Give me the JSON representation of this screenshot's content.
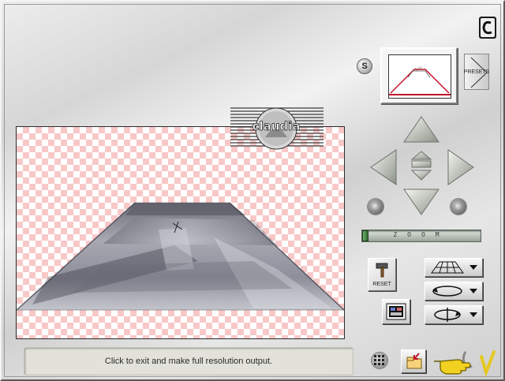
{
  "status": {
    "message": "Click to exit and make full resolution output."
  },
  "presets": {
    "label": "PRESETS",
    "s_badge": "S",
    "thumbnail_icon": "perspective-road-preview"
  },
  "logo": {
    "text": "claudia"
  },
  "zoom": {
    "label": "ZOOM",
    "value_fraction": 0.0
  },
  "reset": {
    "label": "RESET"
  },
  "navigation": {
    "icons": [
      "arrow-up-icon",
      "arrow-left-icon",
      "arrow-right-icon",
      "arrow-down-icon",
      "center-icon",
      "rotate-left-knob",
      "rotate-right-knob"
    ]
  },
  "modes": {
    "icons": [
      "perspective-grid-icon",
      "rotate-flat-icon",
      "rotate-vertical-icon"
    ]
  },
  "footer": {
    "icons": [
      "grid-icon",
      "export-icon",
      "ok-hand-icon"
    ]
  },
  "colors": {
    "checker": "#f8c8c8",
    "road_red": "#c0142a",
    "zoom_green": "#3f8a3f"
  }
}
